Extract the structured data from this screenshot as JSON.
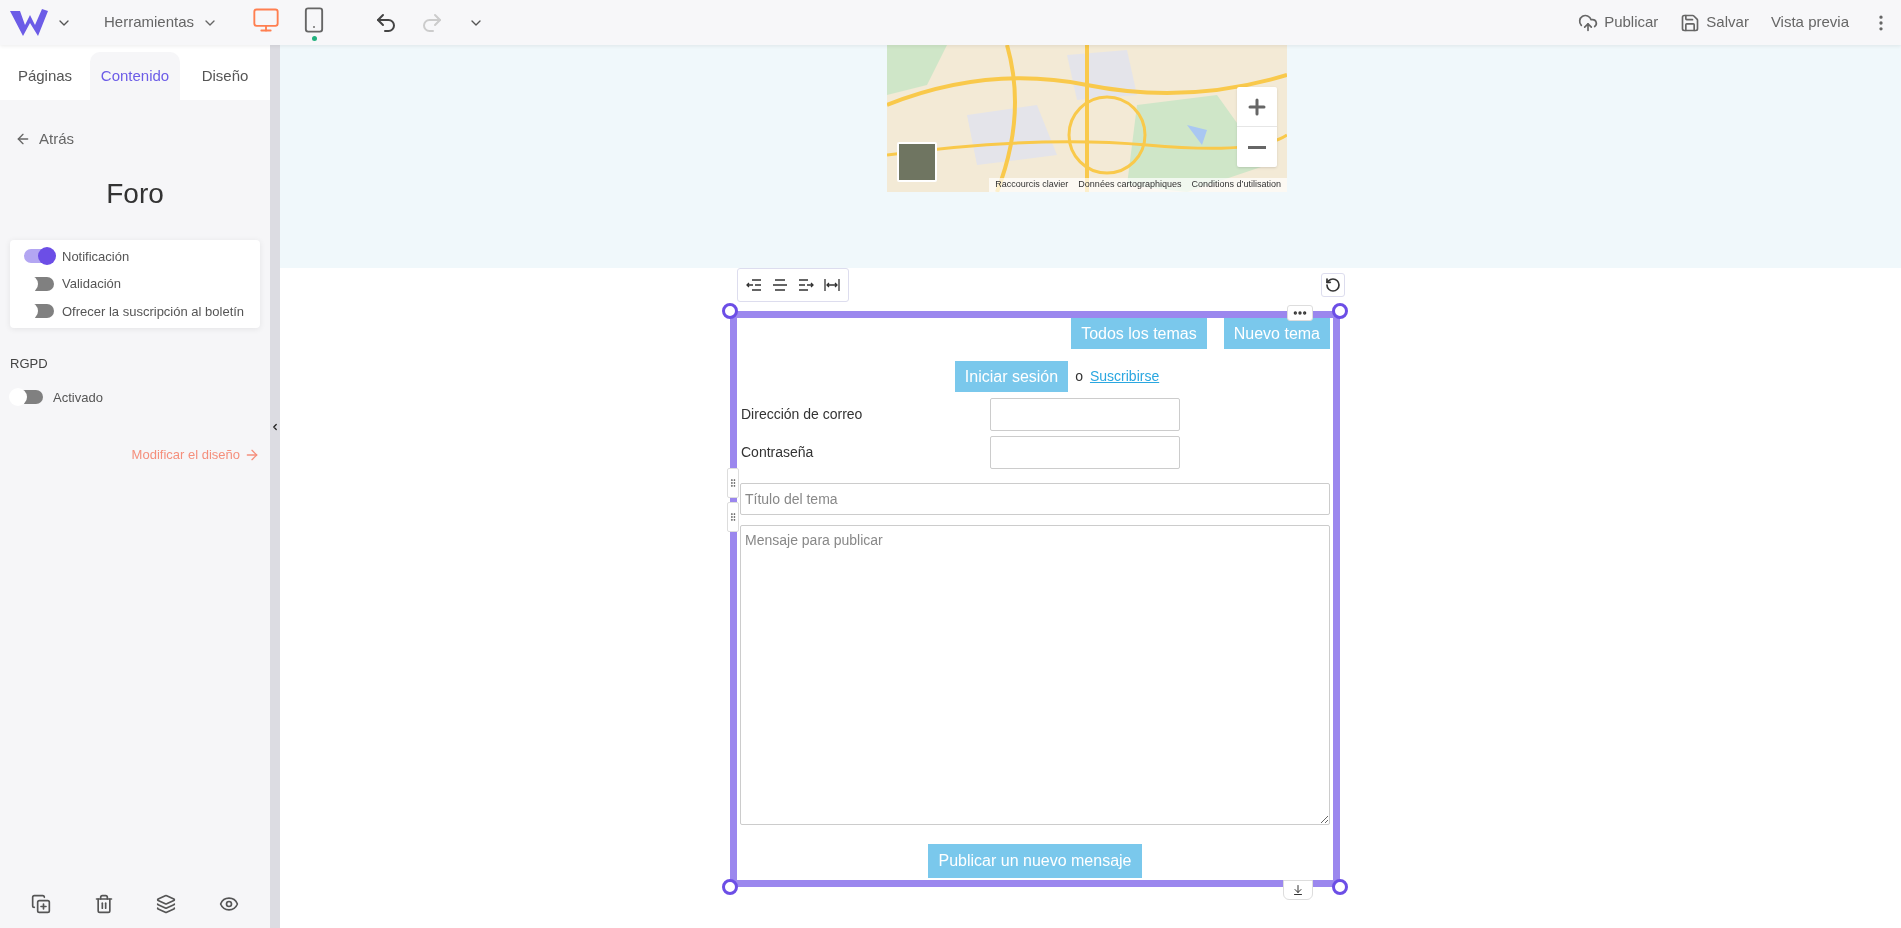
{
  "toolbar": {
    "menu": "Herramientas",
    "devices": [
      {
        "kind": "desktop",
        "selected": true
      },
      {
        "kind": "mobile",
        "selected": false
      }
    ],
    "actions": [
      {
        "kind": "publish",
        "label": "Publicar"
      },
      {
        "kind": "save",
        "label": "Salvar"
      },
      {
        "kind": "preview",
        "label": "Vista previa"
      }
    ]
  },
  "sidebar": {
    "tabs": [
      {
        "label": "Páginas",
        "selected": false
      },
      {
        "label": "Contenido",
        "selected": true
      },
      {
        "label": "Diseño",
        "selected": false
      }
    ],
    "back": "Atrás",
    "title": "Foro",
    "options": [
      {
        "label": "Notificación",
        "on": true
      },
      {
        "label": "Validación",
        "on": false
      },
      {
        "label": "Ofrecer la suscripción al boletín",
        "on": false
      }
    ],
    "section": "RGPD",
    "gdpr": {
      "label": "Activado",
      "on": false
    },
    "link": "Modificar el diseño"
  },
  "map": {
    "attribution": [
      "Raccourcis clavier",
      "Données cartographiques",
      "Conditions d’utilisation"
    ]
  },
  "forum": {
    "nav_buttons": [
      "Todos los temas",
      "Nuevo tema"
    ],
    "login_button": "Iniciar sesión",
    "or": "o",
    "signup_link": "Suscribirse",
    "fields": [
      {
        "label": "Dirección de correo"
      },
      {
        "label": "Contraseña"
      }
    ],
    "topic_placeholder": "Título del tema",
    "message_placeholder": "Mensaje para publicar",
    "submit": "Publicar un nuevo mensaje"
  }
}
